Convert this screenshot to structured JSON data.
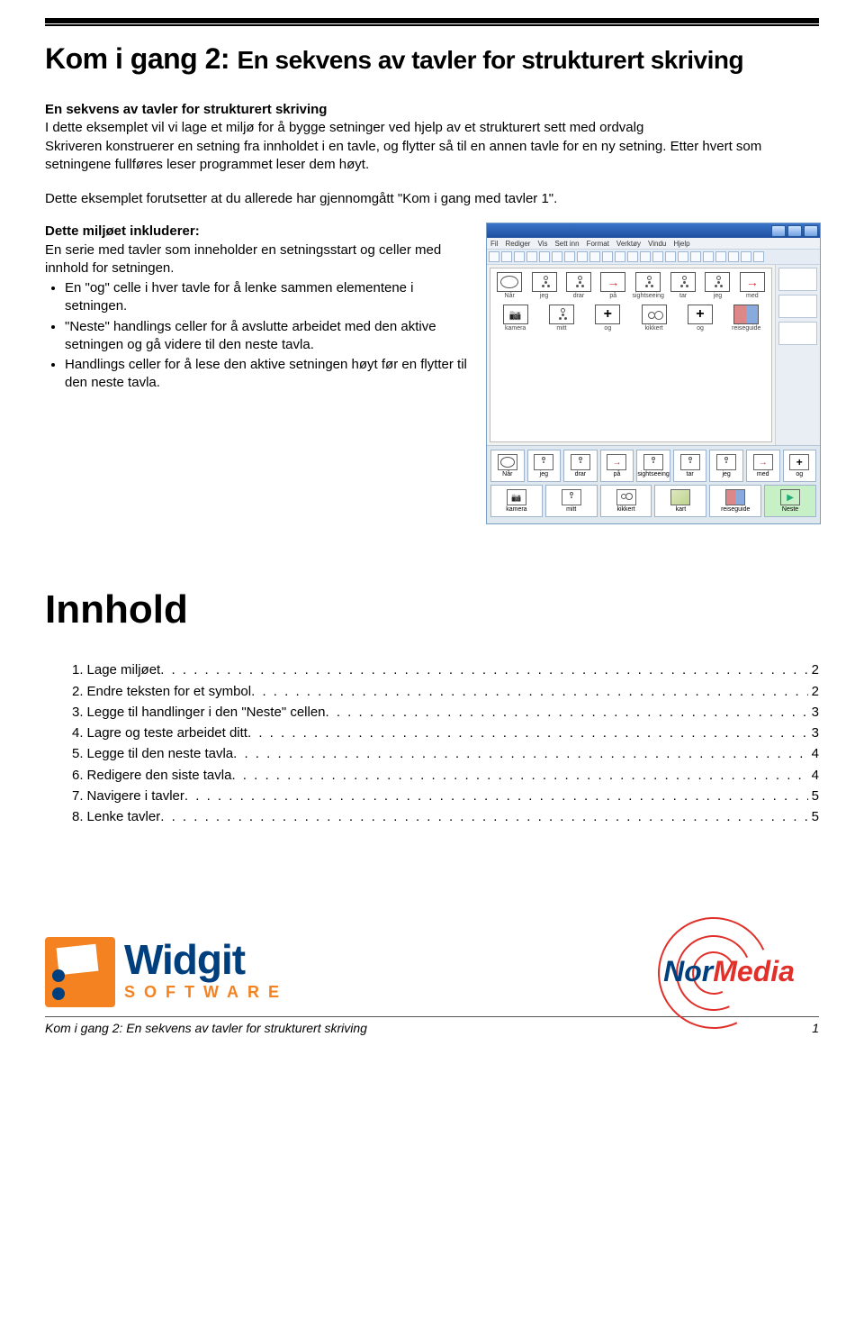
{
  "title_small": "Kom i gang 2:",
  "title_big": "En sekvens av tavler for strukturert skriving",
  "subhead": "En sekvens av tavler for strukturert skriving",
  "intro1": "I dette eksemplet vil vi lage et miljø for å bygge setninger ved hjelp av et strukturert sett med ordvalg",
  "intro2": "Skriveren konstruerer en setning fra innholdet i en tavle, og flytter så til en annen tavle for en ny setning. Etter hvert som setningene fullføres leser programmet leser dem høyt.",
  "intro3": "Dette eksemplet forutsetter at du allerede har gjennomgått \"Kom i gang med tavler 1\".",
  "incl_title": "Dette miljøet inkluderer:",
  "incl_lead": "En serie med tavler som inneholder en setningsstart og celler med innhold for setningen.",
  "bullets": [
    "En \"og\" celle i hver tavle for å lenke sammen elementene i setningen.",
    "\"Neste\" handlings celler for å avslutte arbeidet med den aktive setningen og gå videre til den neste tavla.",
    "Handlings celler for å lese den aktive setningen høyt før en flytter til den neste tavla."
  ],
  "app": {
    "menu": [
      "Fil",
      "Rediger",
      "Vis",
      "Sett inn",
      "Format",
      "Verktøy",
      "Vindu",
      "Hjelp"
    ],
    "row1": [
      {
        "cls": "clock",
        "lab": "Når"
      },
      {
        "cls": "stick",
        "lab": "jeg"
      },
      {
        "cls": "stick",
        "lab": "drar"
      },
      {
        "cls": "arrow",
        "lab": "på"
      },
      {
        "cls": "stick",
        "lab": "sightseeing"
      },
      {
        "cls": "stick",
        "lab": "tar"
      },
      {
        "cls": "stick",
        "lab": "jeg"
      },
      {
        "cls": "arrow",
        "lab": "med"
      }
    ],
    "row2": [
      {
        "cls": "camera",
        "lab": "kamera"
      },
      {
        "cls": "stick",
        "lab": "mitt"
      },
      {
        "cls": "plus",
        "lab": "og"
      },
      {
        "cls": "bino",
        "lab": "kikkert"
      },
      {
        "cls": "plus",
        "lab": "og"
      },
      {
        "cls": "book",
        "lab": "reiseguide"
      }
    ],
    "grid1": [
      {
        "cls": "clock",
        "lab": "Når"
      },
      {
        "cls": "stick",
        "lab": "jeg"
      },
      {
        "cls": "stick",
        "lab": "drar"
      },
      {
        "cls": "arrow",
        "lab": "på"
      },
      {
        "cls": "stick",
        "lab": "sightseeing"
      },
      {
        "cls": "stick",
        "lab": "tar"
      },
      {
        "cls": "stick",
        "lab": "jeg"
      },
      {
        "cls": "arrow",
        "lab": "med"
      },
      {
        "cls": "plus",
        "lab": "og"
      }
    ],
    "grid2": [
      {
        "cls": "camera",
        "lab": "kamera"
      },
      {
        "cls": "stick",
        "lab": "mitt"
      },
      {
        "cls": "bino",
        "lab": "kikkert"
      },
      {
        "cls": "map",
        "lab": "kart"
      },
      {
        "cls": "book",
        "lab": "reiseguide"
      },
      {
        "cls": "next",
        "lab": "Neste",
        "green": true
      }
    ]
  },
  "innhold_heading": "Innhold",
  "toc": [
    {
      "n": "1.",
      "t": "Lage miljøet",
      "p": "2"
    },
    {
      "n": "2.",
      "t": "Endre teksten for et symbol",
      "p": "2"
    },
    {
      "n": "3.",
      "t": "Legge til handlinger i den \"Neste\" cellen",
      "p": "3"
    },
    {
      "n": "4.",
      "t": "Lagre og teste arbeidet ditt",
      "p": "3"
    },
    {
      "n": "5.",
      "t": "Legge til den neste tavla",
      "p": "4"
    },
    {
      "n": "6.",
      "t": "Redigere den siste tavla",
      "p": "4"
    },
    {
      "n": "7.",
      "t": "Navigere i tavler",
      "p": "5"
    },
    {
      "n": "8.",
      "t": "Lenke tavler",
      "p": "5"
    }
  ],
  "logos": {
    "widgit_brand": "Widgit",
    "widgit_soft": "SOFTWARE",
    "normedia_nor": "Nor",
    "normedia_media": "Media"
  },
  "footer_left": "Kom i gang 2: En sekvens av tavler for strukturert skriving",
  "footer_page": "1"
}
